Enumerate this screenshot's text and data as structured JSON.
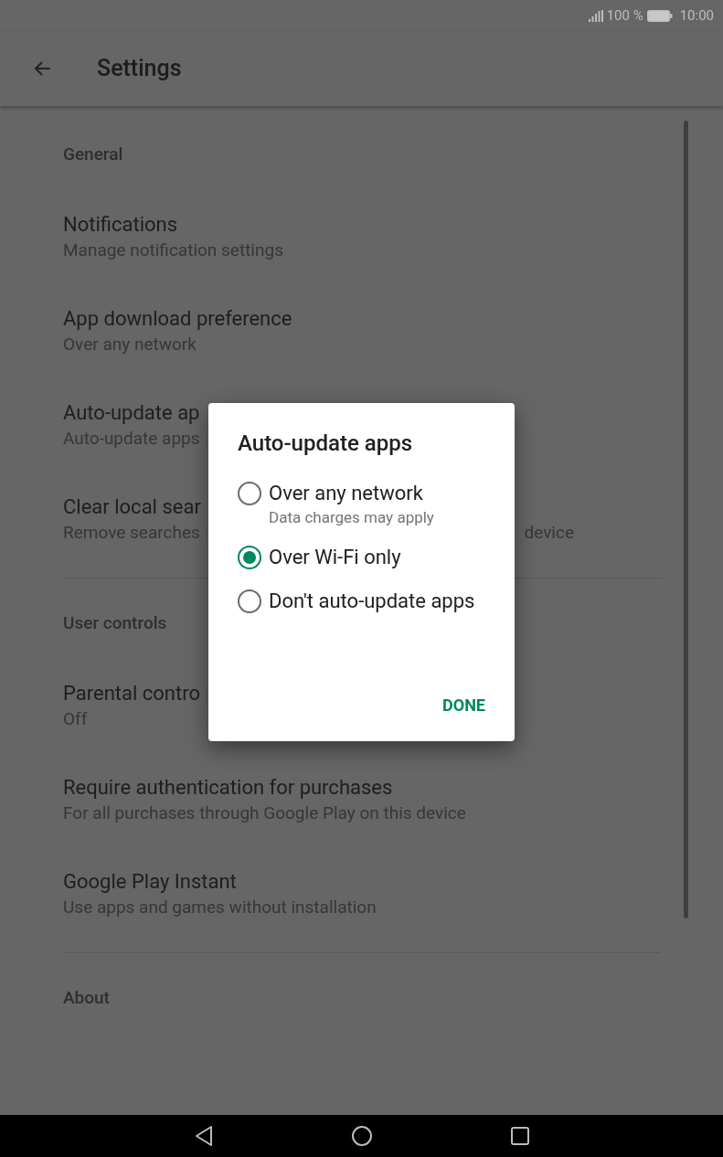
{
  "status_bar": {
    "battery": "100 %",
    "time": "10:00"
  },
  "toolbar": {
    "title": "Settings"
  },
  "settings": [
    {
      "kind": "header",
      "title": "General"
    },
    {
      "kind": "item",
      "title": "Notifications",
      "subtitle": "Manage notification settings"
    },
    {
      "kind": "item",
      "title": "App download preference",
      "subtitle": "Over any network"
    },
    {
      "kind": "item",
      "title": "Auto-update ap",
      "subtitle": "Auto-update apps"
    },
    {
      "kind": "item",
      "title": "Clear local sear",
      "subtitle": "Remove searches",
      "subtitle_end": "device"
    },
    {
      "kind": "divider"
    },
    {
      "kind": "header",
      "title": "User controls"
    },
    {
      "kind": "item",
      "title": "Parental contro",
      "subtitle": "Off"
    },
    {
      "kind": "item",
      "title": "Require authentication for purchases",
      "subtitle": "For all purchases through Google Play on this device"
    },
    {
      "kind": "item",
      "title": "Google Play Instant",
      "subtitle": "Use apps and games without installation"
    },
    {
      "kind": "divider"
    },
    {
      "kind": "header",
      "title": "About"
    }
  ],
  "dialog": {
    "title": "Auto-update apps",
    "options": [
      {
        "label": "Over any network",
        "hint": "Data charges may apply",
        "selected": false
      },
      {
        "label": "Over Wi-Fi only",
        "selected": true
      },
      {
        "label": "Don't auto-update apps",
        "selected": false
      }
    ],
    "button": "DONE"
  }
}
